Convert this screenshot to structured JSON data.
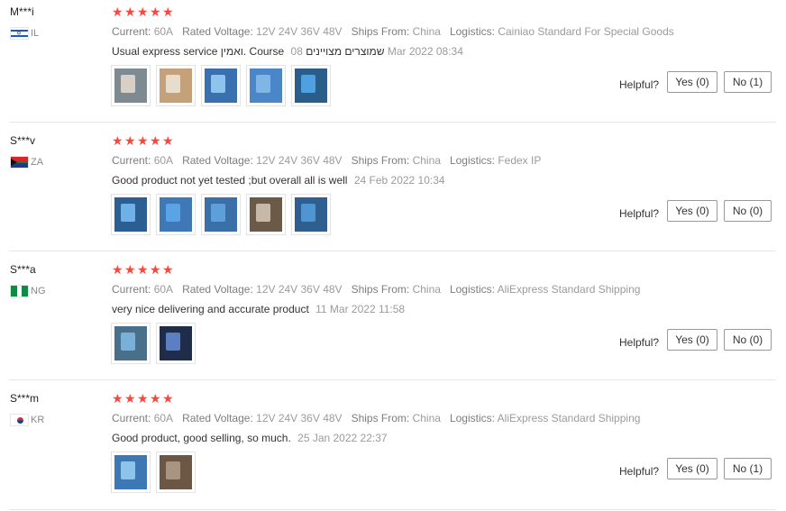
{
  "reviews": [
    {
      "user": "M***i",
      "country_code": "IL",
      "flag": "israel-flag-icon",
      "rating": 5,
      "attributes": [
        {
          "key": "Current:",
          "value": "60A"
        },
        {
          "key": "Rated Voltage:",
          "value": "12V 24V 36V 48V"
        },
        {
          "key": "Ships From:",
          "value": "China"
        },
        {
          "key": "Logistics:",
          "value": "Cainiao Standard For Special Goods"
        }
      ],
      "text": "Usual express service ואמין. Course שמוצרים מצויינים",
      "date": "08 Mar 2022 08:34",
      "photos": 5,
      "helpful_label": "Helpful?",
      "yes_label": "Yes (0)",
      "no_label": "No (1)"
    },
    {
      "user": "S***v",
      "country_code": "ZA",
      "flag": "south-africa-flag-icon",
      "rating": 5,
      "attributes": [
        {
          "key": "Current:",
          "value": "60A"
        },
        {
          "key": "Rated Voltage:",
          "value": "12V 24V 36V 48V"
        },
        {
          "key": "Ships From:",
          "value": "China"
        },
        {
          "key": "Logistics:",
          "value": "Fedex IP"
        }
      ],
      "text": "Good product not yet tested ;but overall all is well",
      "date": "24 Feb 2022 10:34",
      "photos": 5,
      "helpful_label": "Helpful?",
      "yes_label": "Yes (0)",
      "no_label": "No (0)"
    },
    {
      "user": "S***a",
      "country_code": "NG",
      "flag": "nigeria-flag-icon",
      "rating": 5,
      "attributes": [
        {
          "key": "Current:",
          "value": "60A"
        },
        {
          "key": "Rated Voltage:",
          "value": "12V 24V 36V 48V"
        },
        {
          "key": "Ships From:",
          "value": "China"
        },
        {
          "key": "Logistics:",
          "value": "AliExpress Standard Shipping"
        }
      ],
      "text": "very nice delivering and accurate product",
      "date": "11 Mar 2022 11:58",
      "photos": 2,
      "helpful_label": "Helpful?",
      "yes_label": "Yes (0)",
      "no_label": "No (0)"
    },
    {
      "user": "S***m",
      "country_code": "KR",
      "flag": "south-korea-flag-icon",
      "rating": 5,
      "attributes": [
        {
          "key": "Current:",
          "value": "60A"
        },
        {
          "key": "Rated Voltage:",
          "value": "12V 24V 36V 48V"
        },
        {
          "key": "Ships From:",
          "value": "China"
        },
        {
          "key": "Logistics:",
          "value": "AliExpress Standard Shipping"
        }
      ],
      "text": "Good product, good selling, so much.",
      "date": "25 Jan 2022 22:37",
      "photos": 2,
      "helpful_label": "Helpful?",
      "yes_label": "Yes (0)",
      "no_label": "No (1)"
    }
  ],
  "colors": {
    "star": "#f5483e",
    "muted": "#9b9b9b",
    "divider": "#e6e6e6"
  }
}
